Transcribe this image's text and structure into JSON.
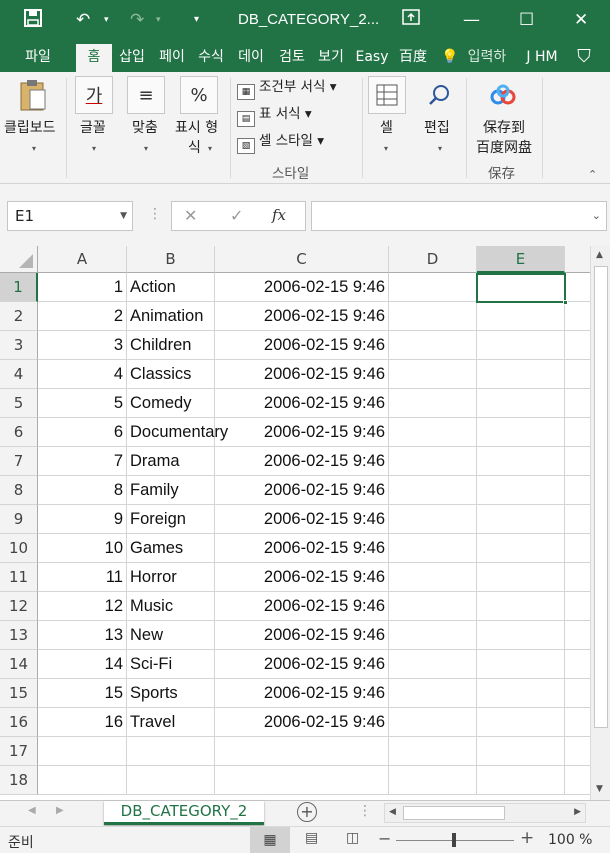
{
  "window": {
    "title": "DB_CATEGORY_2...",
    "save_icon": "save-icon",
    "undo_icon": "undo-icon",
    "redo_icon": "redo-icon",
    "minimize_icon": "minimize-icon",
    "maximize_icon": "maximize-icon",
    "close_icon": "close-icon",
    "restore_ribbon_icon": "ribbon-display-icon"
  },
  "ribbon_tabs": [
    "파일",
    "홈",
    "삽입",
    "페이",
    "수식",
    "데이",
    "검토",
    "보기",
    "Easy",
    "百度",
    "입력하",
    "J HM"
  ],
  "ribbon": {
    "clipboard": {
      "label": "클립보드",
      "icon": "clipboard-icon"
    },
    "font": {
      "label": "글꼴",
      "glyph": "가"
    },
    "align": {
      "label": "맞춤",
      "glyph": "≡"
    },
    "number": {
      "label_line1": "표시 형",
      "label_line2": "식",
      "glyph": "%"
    },
    "styles": {
      "conditional": "조건부 서식",
      "table": "표 서식",
      "cell": "셀 스타일",
      "group_label": "스타일"
    },
    "cells": {
      "label": "셀"
    },
    "edit": {
      "label": "편집"
    },
    "baidu": {
      "line1": "保存到",
      "line2": "百度网盘",
      "group_label": "保存"
    }
  },
  "formula_bar": {
    "name_box": "E1",
    "cancel_icon": "cancel-icon",
    "enter_icon": "check-icon",
    "fx": "fx",
    "formula": ""
  },
  "columns": [
    "A",
    "B",
    "C",
    "D",
    "E"
  ],
  "rows": [
    {
      "n": "1",
      "a": "1",
      "b": "Action",
      "c": "2006-02-15 9:46"
    },
    {
      "n": "2",
      "a": "2",
      "b": "Animation",
      "c": "2006-02-15 9:46"
    },
    {
      "n": "3",
      "a": "3",
      "b": "Children",
      "c": "2006-02-15 9:46"
    },
    {
      "n": "4",
      "a": "4",
      "b": "Classics",
      "c": "2006-02-15 9:46"
    },
    {
      "n": "5",
      "a": "5",
      "b": "Comedy",
      "c": "2006-02-15 9:46"
    },
    {
      "n": "6",
      "a": "6",
      "b": "Documentary",
      "c": "2006-02-15 9:46"
    },
    {
      "n": "7",
      "a": "7",
      "b": "Drama",
      "c": "2006-02-15 9:46"
    },
    {
      "n": "8",
      "a": "8",
      "b": "Family",
      "c": "2006-02-15 9:46"
    },
    {
      "n": "9",
      "a": "9",
      "b": "Foreign",
      "c": "2006-02-15 9:46"
    },
    {
      "n": "10",
      "a": "10",
      "b": "Games",
      "c": "2006-02-15 9:46"
    },
    {
      "n": "11",
      "a": "11",
      "b": "Horror",
      "c": "2006-02-15 9:46"
    },
    {
      "n": "12",
      "a": "12",
      "b": "Music",
      "c": "2006-02-15 9:46"
    },
    {
      "n": "13",
      "a": "13",
      "b": "New",
      "c": "2006-02-15 9:46"
    },
    {
      "n": "14",
      "a": "14",
      "b": "Sci-Fi",
      "c": "2006-02-15 9:46"
    },
    {
      "n": "15",
      "a": "15",
      "b": "Sports",
      "c": "2006-02-15 9:46"
    },
    {
      "n": "16",
      "a": "16",
      "b": "Travel",
      "c": "2006-02-15 9:46"
    },
    {
      "n": "17",
      "a": "",
      "b": "",
      "c": ""
    },
    {
      "n": "18",
      "a": "",
      "b": "",
      "c": ""
    }
  ],
  "sheet_tab": "DB_CATEGORY_2",
  "status": {
    "ready": "준비",
    "zoom": "100 %"
  },
  "colors": {
    "accent": "#217346"
  }
}
